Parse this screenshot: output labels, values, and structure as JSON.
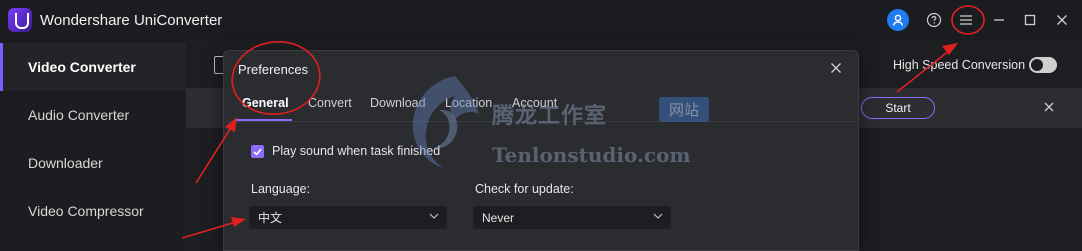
{
  "titlebar": {
    "app_title": "Wondershare UniConverter",
    "icons": [
      "account-icon",
      "help-icon",
      "menu-icon",
      "minimize-icon",
      "maximize-icon",
      "close-icon"
    ]
  },
  "sidebar": {
    "items": [
      {
        "label": "Video Converter",
        "active": true
      },
      {
        "label": "Audio Converter",
        "active": false
      },
      {
        "label": "Downloader",
        "active": false
      },
      {
        "label": "Video Compressor",
        "active": false
      }
    ]
  },
  "main": {
    "high_speed_label": "High Speed Conversion",
    "start_label": "Start"
  },
  "dialog": {
    "title": "Preferences",
    "tabs": [
      "General",
      "Convert",
      "Download",
      "Location",
      "Account"
    ],
    "active_tab": "General",
    "play_sound_label": "Play sound when task finished",
    "play_sound_checked": true,
    "language_label": "Language:",
    "language_value": "中文",
    "update_label": "Check for update:",
    "update_value": "Never"
  },
  "watermark": {
    "cn_text": "腾龙工作室",
    "badge_text": "网站",
    "en_text": "Tenlonstudio.com"
  },
  "colors": {
    "accent": "#8d6cff",
    "annotation": "#e02020",
    "avatar": "#1e7cf0"
  }
}
